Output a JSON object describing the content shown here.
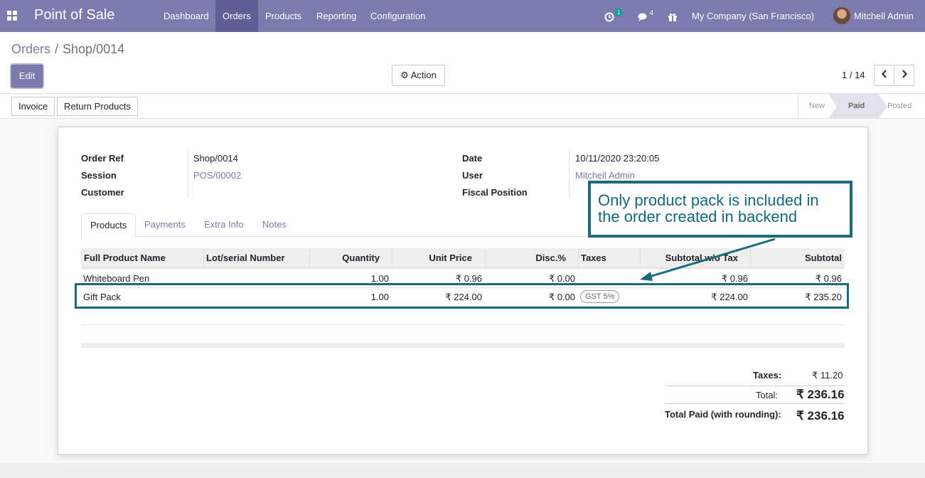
{
  "app": {
    "title": "Point of Sale"
  },
  "nav": {
    "menu": [
      {
        "label": "Dashboard"
      },
      {
        "label": "Orders"
      },
      {
        "label": "Products"
      },
      {
        "label": "Reporting"
      },
      {
        "label": "Configuration"
      }
    ]
  },
  "systray": {
    "activity_count": "1",
    "messages_count": "4",
    "company": "My Company (San Francisco)",
    "user": "Mitchell Admin"
  },
  "breadcrumb": {
    "parent": "Orders",
    "separator": "/",
    "current": "Shop/0014"
  },
  "buttons": {
    "edit": "Edit",
    "action": "Action",
    "invoice": "Invoice",
    "return": "Return Products"
  },
  "pager": {
    "text": "1 / 14"
  },
  "status": {
    "stages": [
      {
        "label": "New"
      },
      {
        "label": "Paid"
      },
      {
        "label": "Posted"
      }
    ],
    "current": "Paid"
  },
  "form": {
    "order_ref_label": "Order Ref",
    "order_ref": "Shop/0014",
    "session_label": "Session",
    "session": "POS/00002",
    "customer_label": "Customer",
    "customer": "",
    "date_label": "Date",
    "date": "10/11/2020 23:20:05",
    "user_label": "User",
    "user": "Mitchell Admin",
    "fiscal_label": "Fiscal Position",
    "fiscal": ""
  },
  "tabs": [
    {
      "label": "Products"
    },
    {
      "label": "Payments"
    },
    {
      "label": "Extra Info"
    },
    {
      "label": "Notes"
    }
  ],
  "table": {
    "headers": [
      "Full Product Name",
      "Lot/serial Number",
      "Quantity",
      "Unit Price",
      "Disc.%",
      "Taxes",
      "Subtotal w/o Tax",
      "Subtotal"
    ],
    "rows": [
      {
        "name": "Whiteboard Pen",
        "lot": "",
        "qty": "1.00",
        "price": "₹ 0.96",
        "disc": "₹ 0.00",
        "tax": "",
        "subtotal_wo": "₹ 0.96",
        "subtotal": "₹ 0.96"
      },
      {
        "name": "Gift Pack",
        "lot": "",
        "qty": "1.00",
        "price": "₹ 224.00",
        "disc": "₹ 0.00",
        "tax": "GST 5%",
        "subtotal_wo": "₹ 224.00",
        "subtotal": "₹ 235.20"
      }
    ]
  },
  "totals": {
    "taxes_label": "Taxes:",
    "taxes": "₹ 11.20",
    "total_label": "Total:",
    "total": "₹ 236.16",
    "paid_label": "Total Paid (with rounding):",
    "paid": "₹ 236.16"
  },
  "annotation": {
    "text": "Only product pack is included in the order created in backend",
    "color": "#1b6a7e"
  }
}
